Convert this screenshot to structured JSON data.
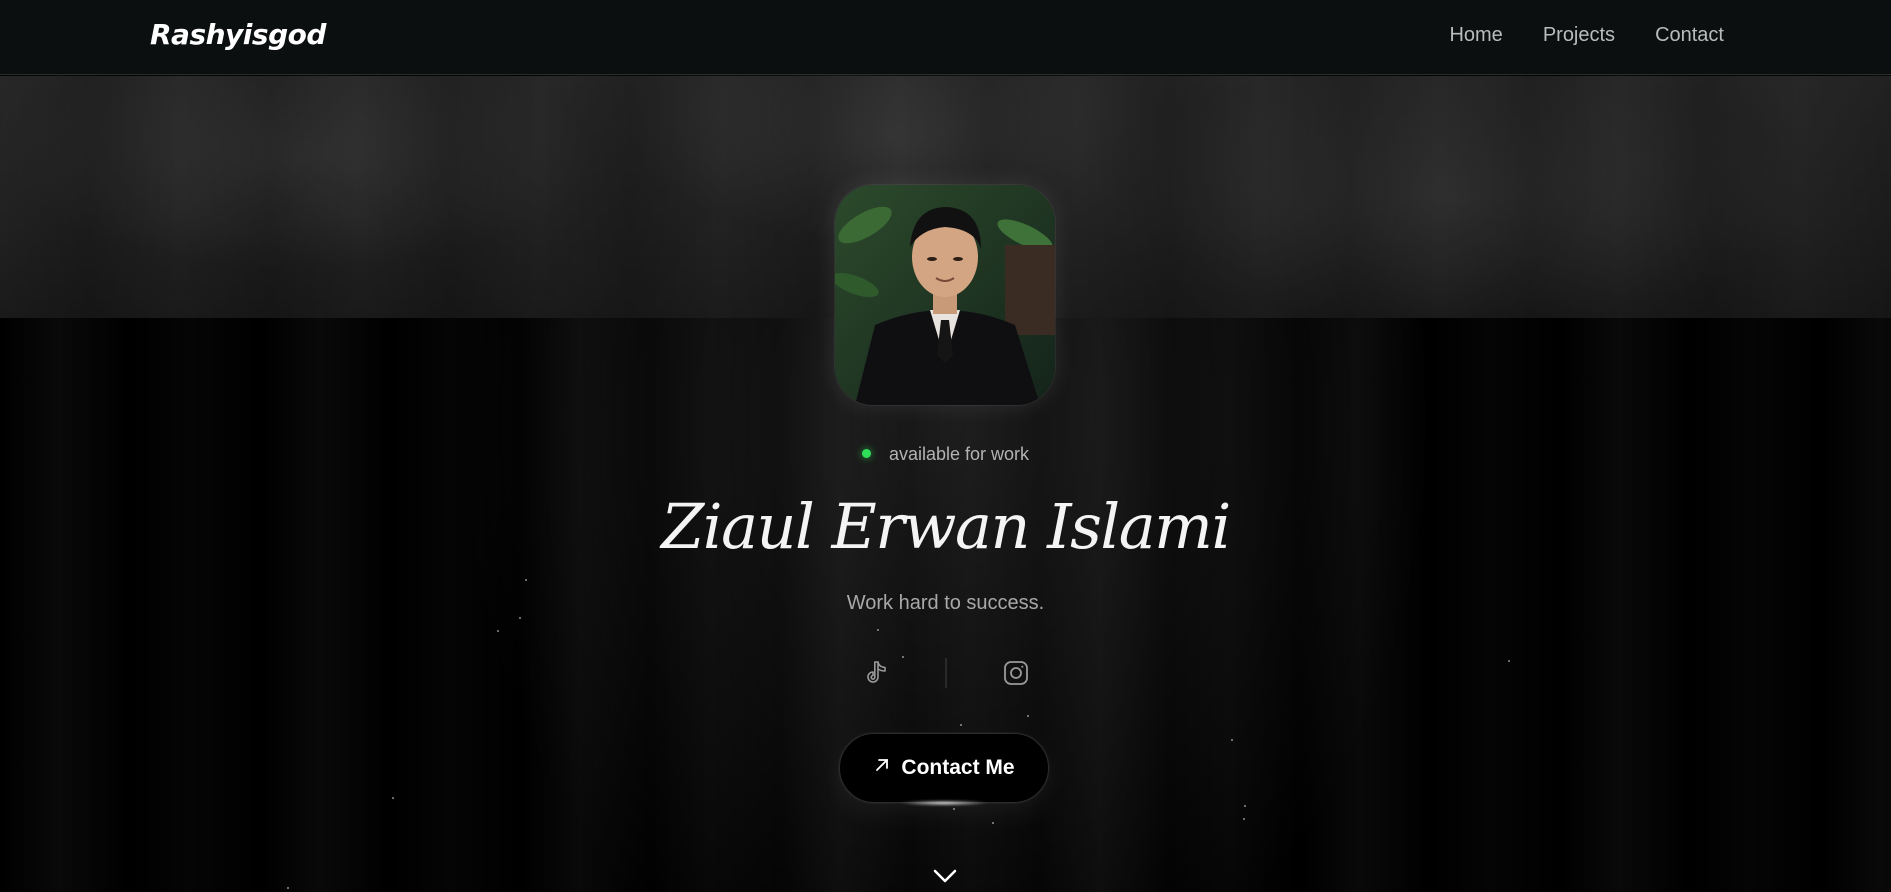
{
  "brand": {
    "name": "Rashyisgod"
  },
  "nav": {
    "items": [
      "Home",
      "Projects",
      "Contact"
    ]
  },
  "hero": {
    "status": "available for work",
    "name": "Ziaul Erwan Islami",
    "tagline": "Work hard to success.",
    "cta_label": "Contact Me"
  },
  "socials": [
    {
      "icon": "tiktok-icon"
    },
    {
      "icon": "instagram-icon"
    }
  ],
  "colors": {
    "status_dot": "#2fe05a",
    "background": "#000000",
    "navbar": "#0c0f0f",
    "text_primary": "#ffffff",
    "text_muted": "#b3b3b3"
  }
}
